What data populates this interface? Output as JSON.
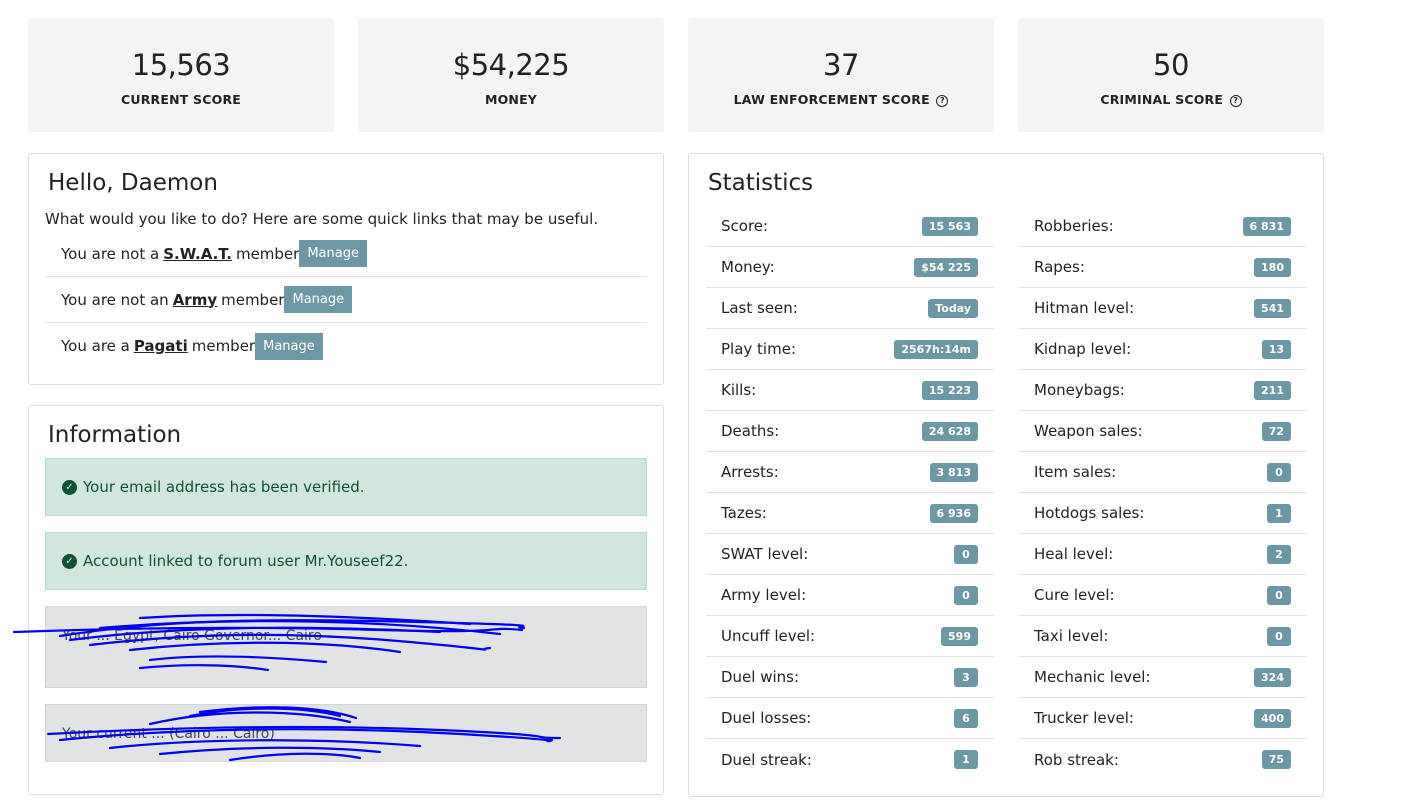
{
  "score_cards": [
    {
      "value": "15,563",
      "label": "CURRENT SCORE",
      "help": false
    },
    {
      "value": "$54,225",
      "label": "MONEY",
      "help": false
    },
    {
      "value": "37",
      "label": "LAW ENFORCEMENT SCORE",
      "help": true
    },
    {
      "value": "50",
      "label": "CRIMINAL SCORE",
      "help": true
    }
  ],
  "hello": {
    "title": "Hello, Daemon",
    "subtitle": "What would you like to do? Here are some quick links that may be useful.",
    "links": [
      {
        "prefix": "You are not a",
        "group": "S.W.A.T.",
        "suffix": "member",
        "button": "Manage"
      },
      {
        "prefix": "You are not an",
        "group": "Army",
        "suffix": "member",
        "button": "Manage"
      },
      {
        "prefix": "You are a",
        "group": "Pagati",
        "suffix": "member",
        "button": "Manage"
      }
    ]
  },
  "information": {
    "title": "Information",
    "alerts": [
      "Your email address has been verified.",
      "Account linked to forum user Mr.Youseef22."
    ],
    "notes": [
      "Your ... Egypt, Cairo Governor... Cairo",
      "Your current ... (Cairo ... Cairo)"
    ]
  },
  "statistics": {
    "title": "Statistics",
    "left": [
      {
        "label": "Score:",
        "value": "15 563"
      },
      {
        "label": "Money:",
        "value": "$54 225"
      },
      {
        "label": "Last seen:",
        "value": "Today"
      },
      {
        "label": "Play time:",
        "value": "2567h:14m"
      },
      {
        "label": "Kills:",
        "value": "15 223"
      },
      {
        "label": "Deaths:",
        "value": "24 628"
      },
      {
        "label": "Arrests:",
        "value": "3 813"
      },
      {
        "label": "Tazes:",
        "value": "6 936"
      },
      {
        "label": "SWAT level:",
        "value": "0"
      },
      {
        "label": "Army level:",
        "value": "0"
      },
      {
        "label": "Uncuff level:",
        "value": "599"
      },
      {
        "label": "Duel wins:",
        "value": "3"
      },
      {
        "label": "Duel losses:",
        "value": "6"
      },
      {
        "label": "Duel streak:",
        "value": "1"
      }
    ],
    "right": [
      {
        "label": "Robberies:",
        "value": "6 831"
      },
      {
        "label": "Rapes:",
        "value": "180"
      },
      {
        "label": "Hitman level:",
        "value": "541"
      },
      {
        "label": "Kidnap level:",
        "value": "13"
      },
      {
        "label": "Moneybags:",
        "value": "211"
      },
      {
        "label": "Weapon sales:",
        "value": "72"
      },
      {
        "label": "Item sales:",
        "value": "0"
      },
      {
        "label": "Hotdogs sales:",
        "value": "1"
      },
      {
        "label": "Heal level:",
        "value": "2"
      },
      {
        "label": "Cure level:",
        "value": "0"
      },
      {
        "label": "Taxi level:",
        "value": "0"
      },
      {
        "label": "Mechanic level:",
        "value": "324"
      },
      {
        "label": "Trucker level:",
        "value": "400"
      },
      {
        "label": "Rob streak:",
        "value": "75"
      }
    ]
  },
  "colors": {
    "badge": "#6c98a6",
    "card_bg": "#f4f4f4",
    "success_bg": "#d1e7dd",
    "note_bg": "#e2e3e5",
    "redaction": "#0000ee"
  }
}
